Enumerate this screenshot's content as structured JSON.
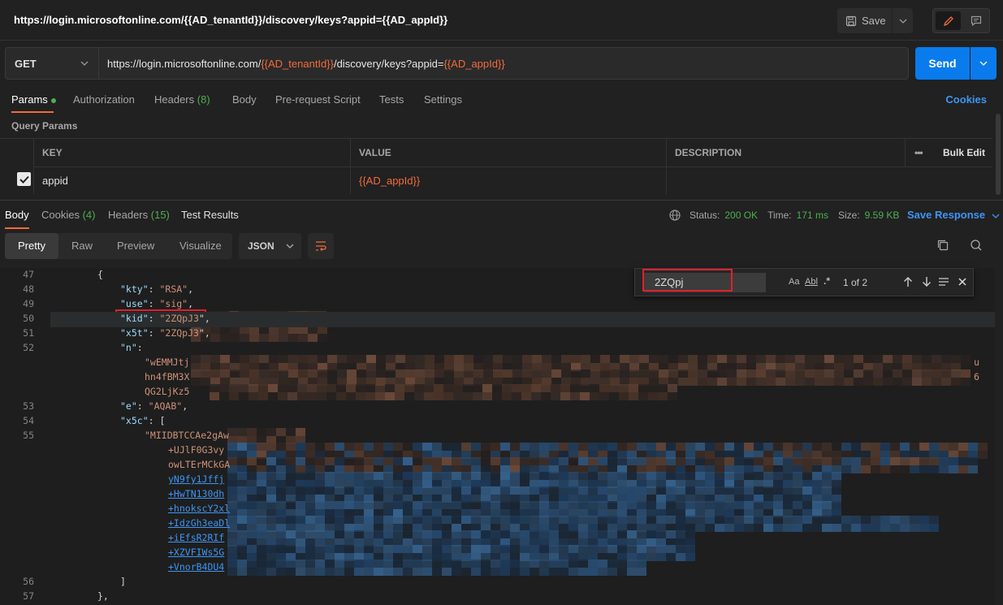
{
  "title": "https://login.microsoftonline.com/{{AD_tenantId}}/discovery/keys?appid={{AD_appId}}",
  "toolbar": {
    "save_label": "Save"
  },
  "request": {
    "method": "GET",
    "url_prefix": "https://login.microsoftonline.com/",
    "url_var1": "{{AD_tenantId}}",
    "url_mid": "/discovery/keys?appid=",
    "url_var2": "{{AD_appId}}",
    "send_label": "Send"
  },
  "request_tabs": [
    {
      "label": "Params"
    },
    {
      "label": "Authorization"
    },
    {
      "label": "Headers",
      "count": "(8)"
    },
    {
      "label": "Body"
    },
    {
      "label": "Pre-request Script"
    },
    {
      "label": "Tests"
    },
    {
      "label": "Settings"
    }
  ],
  "cookies_link": "Cookies",
  "query_params_label": "Query Params",
  "table": {
    "headers": [
      "KEY",
      "VALUE",
      "DESCRIPTION",
      "•••",
      "Bulk Edit"
    ],
    "row": {
      "key": "appid",
      "value": "{{AD_appId}}",
      "description": ""
    }
  },
  "response_tabs": [
    {
      "label": "Body"
    },
    {
      "label": "Cookies",
      "count": "(4)"
    },
    {
      "label": "Headers",
      "count": "(15)"
    },
    {
      "label": "Test Results"
    }
  ],
  "status": {
    "status_label": "Status:",
    "status_value": "200 OK",
    "time_label": "Time:",
    "time_value": "171 ms",
    "size_label": "Size:",
    "size_value": "9.59 KB",
    "save_response": "Save Response"
  },
  "view_modes": [
    "Pretty",
    "Raw",
    "Preview",
    "Visualize"
  ],
  "format": "JSON",
  "find": {
    "query": "2ZQpj",
    "case_label": "Aa",
    "word_label": "Abl",
    "regex_label": ".*",
    "count": "1 of 2"
  },
  "code_lines": [
    {
      "n": "47",
      "text": "{"
    },
    {
      "n": "48",
      "key": "\"kty\"",
      "sep": ": ",
      "val": "\"RSA\"",
      "end": ","
    },
    {
      "n": "49",
      "key": "\"use\"",
      "sep": ": ",
      "val": "\"sig\"",
      "end": ","
    },
    {
      "n": "50",
      "key": "\"kid\"",
      "sep": ": ",
      "val": "\"2ZQpJ3",
      "end": "\","
    },
    {
      "n": "51",
      "key": "\"x5t\"",
      "sep": ": ",
      "val": "\"2ZQpJ3",
      "end": "\","
    },
    {
      "n": "52",
      "key": "\"n\"",
      "sep": ":",
      "val": "",
      "end": ""
    },
    {
      "n": "",
      "val": "\"wEMMJtj",
      "tail": "u"
    },
    {
      "n": "",
      "val": "hn4fBM3X",
      "tail": "6"
    },
    {
      "n": "",
      "val": "QG2LjKz5"
    },
    {
      "n": "53",
      "key": "\"e\"",
      "sep": ": ",
      "val": "\"AQAB\"",
      "end": ","
    },
    {
      "n": "54",
      "key": "\"x5c\"",
      "sep": ": ",
      "val": "",
      "end": "["
    },
    {
      "n": "55",
      "val": "\"MIIDBTCCAe2gAw"
    },
    {
      "n": "",
      "val": "+UJlF0G3vy"
    },
    {
      "n": "",
      "val": "owLTErMCkGA"
    },
    {
      "n": "",
      "link": "yN9fy1Jffj"
    },
    {
      "n": "",
      "link": "+HwTN130dh"
    },
    {
      "n": "",
      "link": "+hnokscY2xl"
    },
    {
      "n": "",
      "link": "+IdzGh3eaDl"
    },
    {
      "n": "",
      "link": "+iEfsR2RIf"
    },
    {
      "n": "",
      "link": "+XZVFIWs5G"
    },
    {
      "n": "",
      "link": "+VnorB4DU4"
    },
    {
      "n": "56",
      "text": "]"
    },
    {
      "n": "57",
      "text": "},"
    }
  ],
  "colors": {
    "accent": "#f26b3a",
    "send": "#097bed",
    "link": "#3d95f5",
    "ok": "#4caf50",
    "highlight": "#e0202c"
  }
}
